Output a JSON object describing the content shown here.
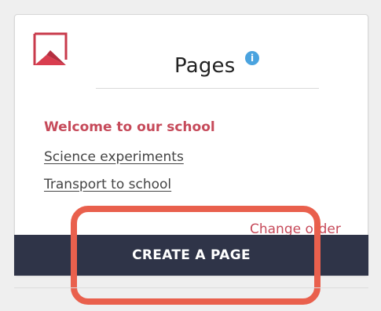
{
  "panel": {
    "title": "Pages",
    "info_icon": "info-icon"
  },
  "pages": [
    {
      "label": "Welcome to our school",
      "active": true
    },
    {
      "label": "Science experiments",
      "active": false
    },
    {
      "label": "Transport to school",
      "active": false
    }
  ],
  "actions": {
    "change_order_label": "Change order",
    "create_label": "CREATE A PAGE"
  },
  "colors": {
    "accent": "#c64a5a",
    "button_bg": "#2f3448",
    "info": "#4aa3df",
    "highlight": "#e9604d"
  }
}
